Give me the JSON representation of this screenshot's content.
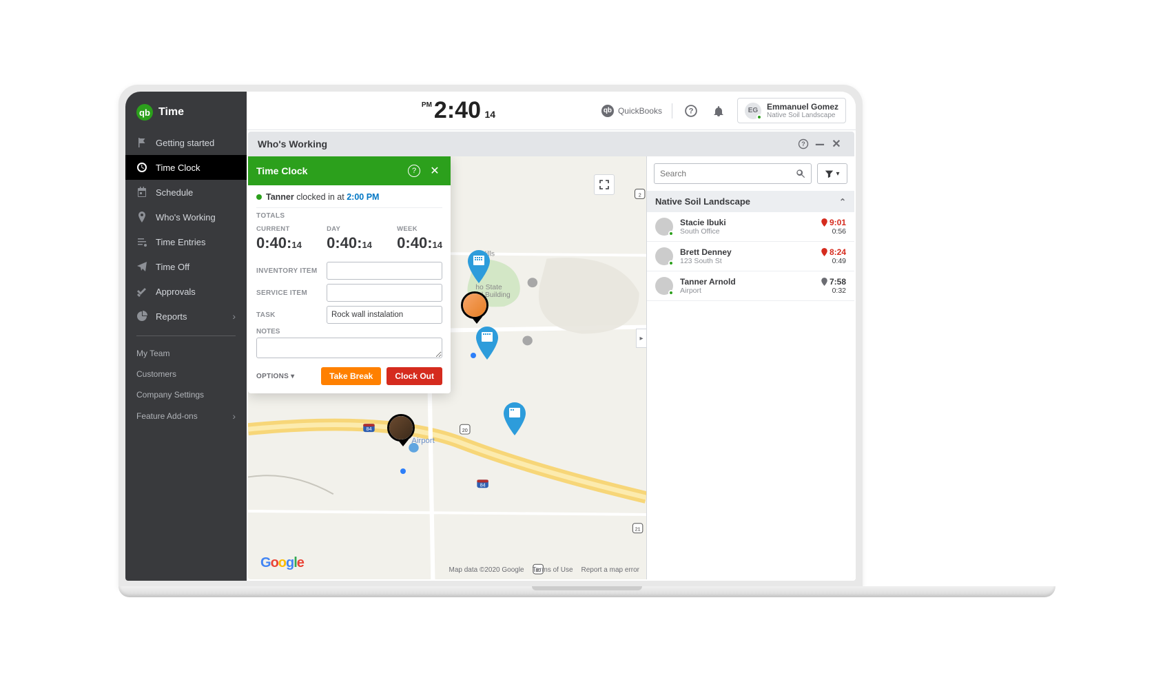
{
  "brand": {
    "name": "Time",
    "logo_text": "qb"
  },
  "sidebar": {
    "items": [
      {
        "label": "Getting started",
        "icon": "flag"
      },
      {
        "label": "Time Clock",
        "icon": "clock"
      },
      {
        "label": "Schedule",
        "icon": "calendar"
      },
      {
        "label": "Who's Working",
        "icon": "pin"
      },
      {
        "label": "Time Entries",
        "icon": "list"
      },
      {
        "label": "Time Off",
        "icon": "plane"
      },
      {
        "label": "Approvals",
        "icon": "checks"
      },
      {
        "label": "Reports",
        "icon": "pie"
      }
    ],
    "subitems": [
      {
        "label": "My Team"
      },
      {
        "label": "Customers"
      },
      {
        "label": "Company Settings"
      },
      {
        "label": "Feature Add-ons"
      }
    ]
  },
  "topbar": {
    "period": "PM",
    "time": "2:40",
    "seconds": "14",
    "quickbooks_label": "QuickBooks",
    "user": {
      "initials": "EG",
      "name": "Emmanuel Gomez",
      "company": "Native Soil Landscape"
    }
  },
  "panel": {
    "title": "Who's Working"
  },
  "timeclock": {
    "title": "Time Clock",
    "status_name": "Tanner",
    "status_verb": "clocked in at",
    "status_time": "2:00 PM",
    "totals_label": "TOTALS",
    "totals": {
      "current": {
        "label": "CURRENT",
        "hhmm": "0:40:",
        "ss": "14"
      },
      "day": {
        "label": "DAY",
        "hhmm": "0:40:",
        "ss": "14"
      },
      "week": {
        "label": "WEEK",
        "hhmm": "0:40:",
        "ss": "14"
      }
    },
    "fields": {
      "inventory_label": "INVENTORY ITEM",
      "inventory_value": "",
      "service_label": "SERVICE ITEM",
      "service_value": "",
      "task_label": "TASK",
      "task_value": "Rock wall instalation",
      "notes_label": "NOTES",
      "notes_value": ""
    },
    "options_label": "OPTIONS",
    "take_break": "Take Break",
    "clock_out": "Clock Out"
  },
  "search": {
    "placeholder": "Search"
  },
  "group": {
    "name": "Native Soil Landscape"
  },
  "employees": [
    {
      "name": "Stacie Ibuki",
      "location": "South Office",
      "time_in": "9:01",
      "duration": "0:56",
      "alert": true
    },
    {
      "name": "Brett Denney",
      "location": "123 South St",
      "time_in": "8:24",
      "duration": "0:49",
      "alert": true
    },
    {
      "name": "Tanner Arnold",
      "location": "Airport",
      "time_in": "7:58",
      "duration": "0:32",
      "alert": false
    }
  ],
  "map_labels": {
    "airport": "Airport",
    "capitol": "ho State\ntol Building",
    "hills": "Hills\nge"
  },
  "map_credits": {
    "data": "Map data ©2020 Google",
    "terms": "Terms of Use",
    "report": "Report a map error"
  }
}
